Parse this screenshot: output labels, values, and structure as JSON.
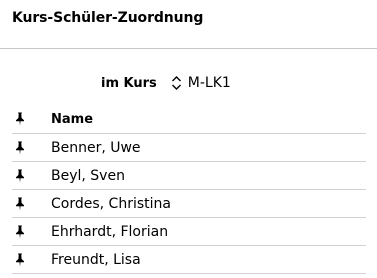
{
  "page": {
    "title": "Kurs-Schüler-Zuordnung"
  },
  "course": {
    "label": "im Kurs",
    "selected": "M-LK1"
  },
  "table": {
    "column_header": "Name",
    "rows": [
      {
        "name": "Benner, Uwe"
      },
      {
        "name": "Beyl, Sven"
      },
      {
        "name": "Cordes, Christina"
      },
      {
        "name": "Ehrhardt, Florian"
      },
      {
        "name": "Freundt, Lisa"
      }
    ]
  },
  "icons": {
    "pin": "pin-icon",
    "course_select": "chevron-up-down-icon"
  }
}
